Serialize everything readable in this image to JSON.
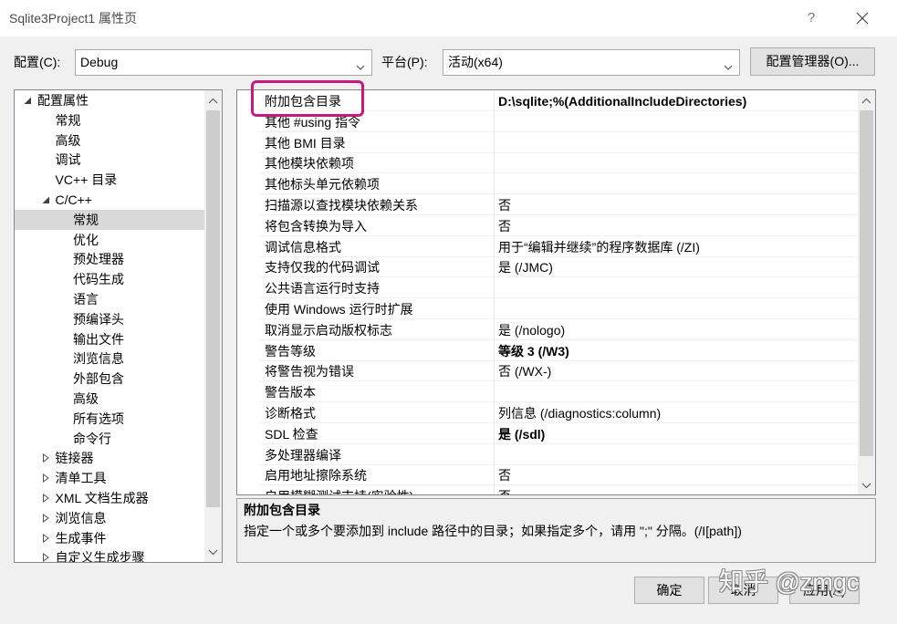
{
  "window": {
    "title": "Sqlite3Project1 属性页",
    "help_label": "?"
  },
  "config_bar": {
    "config_label": "配置(C):",
    "config_value": "Debug",
    "platform_label": "平台(P):",
    "platform_value": "活动(x64)",
    "manager_button": "配置管理器(O)..."
  },
  "tree": {
    "selected_index": 6,
    "items": [
      {
        "label": "配置属性",
        "depth": 0,
        "icon": "expanded-triangle-icon"
      },
      {
        "label": "常规",
        "depth": 1
      },
      {
        "label": "高级",
        "depth": 1
      },
      {
        "label": "调试",
        "depth": 1
      },
      {
        "label": "VC++ 目录",
        "depth": 1
      },
      {
        "label": "C/C++",
        "depth": 1,
        "icon": "expanded-triangle-icon"
      },
      {
        "label": "常规",
        "depth": 2
      },
      {
        "label": "优化",
        "depth": 2
      },
      {
        "label": "预处理器",
        "depth": 2
      },
      {
        "label": "代码生成",
        "depth": 2
      },
      {
        "label": "语言",
        "depth": 2
      },
      {
        "label": "预编译头",
        "depth": 2
      },
      {
        "label": "输出文件",
        "depth": 2
      },
      {
        "label": "浏览信息",
        "depth": 2
      },
      {
        "label": "外部包含",
        "depth": 2
      },
      {
        "label": "高级",
        "depth": 2
      },
      {
        "label": "所有选项",
        "depth": 2
      },
      {
        "label": "命令行",
        "depth": 2
      },
      {
        "label": "链接器",
        "depth": 1,
        "icon": "collapsed-triangle-icon"
      },
      {
        "label": "清单工具",
        "depth": 1,
        "icon": "collapsed-triangle-icon"
      },
      {
        "label": "XML 文档生成器",
        "depth": 1,
        "icon": "collapsed-triangle-icon"
      },
      {
        "label": "浏览信息",
        "depth": 1,
        "icon": "collapsed-triangle-icon"
      },
      {
        "label": "生成事件",
        "depth": 1,
        "icon": "collapsed-triangle-icon"
      },
      {
        "label": "自定义生成步骤",
        "depth": 1,
        "icon": "collapsed-triangle-icon"
      }
    ]
  },
  "grid": {
    "rows": [
      {
        "name": "附加包含目录",
        "value": "D:\\sqlite;%(AdditionalIncludeDirectories)",
        "bold": true
      },
      {
        "name": "其他 #using 指令",
        "value": ""
      },
      {
        "name": "其他 BMI 目录",
        "value": ""
      },
      {
        "name": "其他模块依赖项",
        "value": ""
      },
      {
        "name": "其他标头单元依赖项",
        "value": ""
      },
      {
        "name": "扫描源以查找模块依赖关系",
        "value": "否"
      },
      {
        "name": "将包含转换为导入",
        "value": "否"
      },
      {
        "name": "调试信息格式",
        "value": "用于“编辑并继续”的程序数据库 (/ZI)"
      },
      {
        "name": "支持仅我的代码调试",
        "value": "是 (/JMC)"
      },
      {
        "name": "公共语言运行时支持",
        "value": ""
      },
      {
        "name": "使用 Windows 运行时扩展",
        "value": ""
      },
      {
        "name": "取消显示启动版权标志",
        "value": "是 (/nologo)"
      },
      {
        "name": "警告等级",
        "value": "等级 3 (/W3)",
        "bold": true
      },
      {
        "name": "将警告视为错误",
        "value": "否 (/WX-)"
      },
      {
        "name": "警告版本",
        "value": ""
      },
      {
        "name": "诊断格式",
        "value": "列信息 (/diagnostics:column)"
      },
      {
        "name": "SDL 检查",
        "value": "是 (/sdl)",
        "bold": true
      },
      {
        "name": "多处理器编译",
        "value": ""
      },
      {
        "name": "启用地址擦除系统",
        "value": "否"
      },
      {
        "name": "启用模糊测试支持(实验性)",
        "value": "否"
      }
    ]
  },
  "description": {
    "title": "附加包含目录",
    "text": "指定一个或多个要添加到 include 路径中的目录；如果指定多个，请用 \";\" 分隔。(/I[path])"
  },
  "buttons": {
    "ok": "确定",
    "cancel": "取消",
    "apply": "应用(A)"
  },
  "watermark": "知乎 @zmgc",
  "colors": {
    "window_bg": "#f0f0f0",
    "tree_selection": "#d9d9d9",
    "annotation_highlight": "#c8197c",
    "scroll_thumb": "#cdcdcd"
  }
}
